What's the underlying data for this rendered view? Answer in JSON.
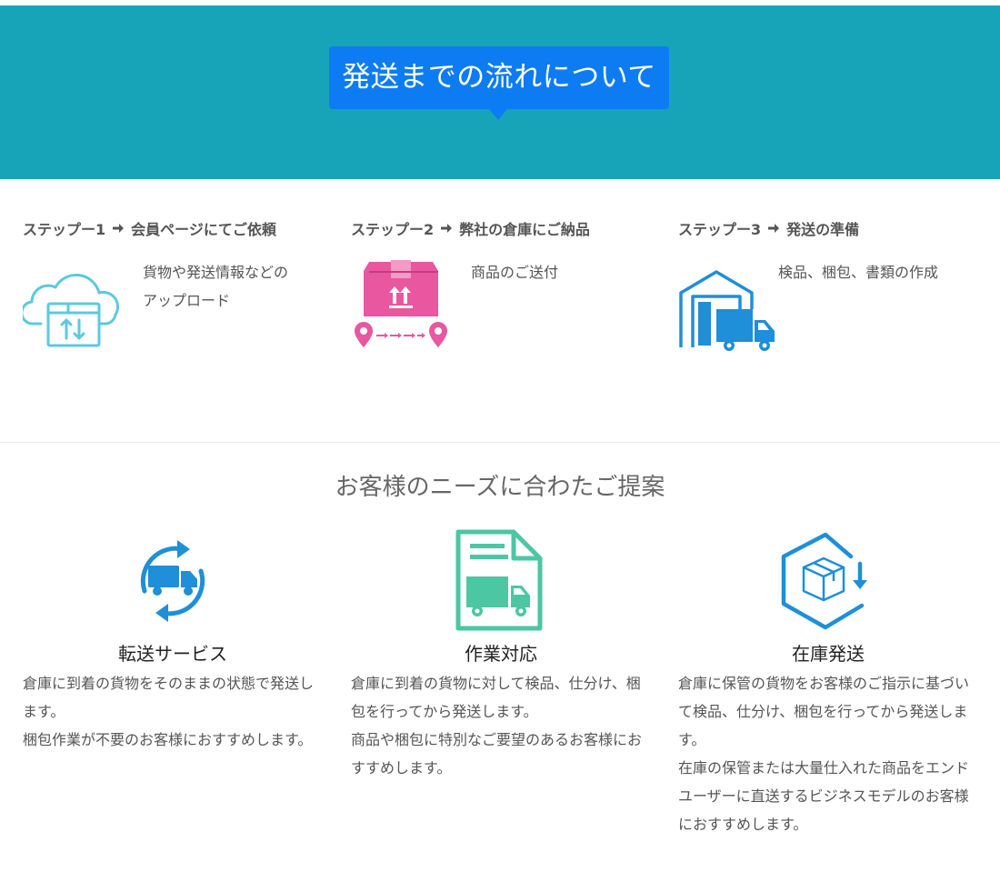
{
  "hero": {
    "title": "発送までの流れについて"
  },
  "steps": [
    {
      "label": "ステップー1",
      "title": "会員ページにてご依頼",
      "desc_lines": [
        "貨物や発送情報などの",
        "アップロード"
      ],
      "icon": "cloud-upload-icon"
    },
    {
      "label": "ステップー2",
      "title": "弊社の倉庫にご納品",
      "desc_lines": [
        "商品のご送付"
      ],
      "icon": "package-delivery-icon"
    },
    {
      "label": "ステップー3",
      "title": "発送の準備",
      "desc_lines": [
        "検品、梱包、書類の作成"
      ],
      "icon": "warehouse-truck-icon"
    }
  ],
  "section": {
    "title": "お客様のニーズに合わたご提案"
  },
  "services": [
    {
      "name": "転送サービス",
      "icon": "truck-cycle-icon",
      "desc": [
        "倉庫に到着の貨物をそのままの状態で発送します。",
        "梱包作業が不要のお客様におすすめします。"
      ]
    },
    {
      "name": "作業対応",
      "icon": "document-truck-icon",
      "desc": [
        "倉庫に到着の貨物に対して検品、仕分け、梱包を行ってから発送します。",
        "商品や梱包に特別なご要望のあるお客様におすすめします。"
      ]
    },
    {
      "name": "在庫発送",
      "icon": "box-hexagon-icon",
      "desc": [
        "倉庫に保管の貨物をお客様のご指示に基づいて検品、仕分け、梱包を行ってから発送します。",
        "在庫の保管または大量仕入れた商品をエンドユーザーに直送するビジネスモデルのお客様におすすめします。"
      ]
    }
  ],
  "colors": {
    "hero_bg": "#17a4b8",
    "badge_bg": "#0d7cf2",
    "cloud_icon": "#5cc9e0",
    "package_icon": "#e8579f",
    "warehouse_icon": "#1e8fd8",
    "doc_icon": "#4cc6a3"
  }
}
